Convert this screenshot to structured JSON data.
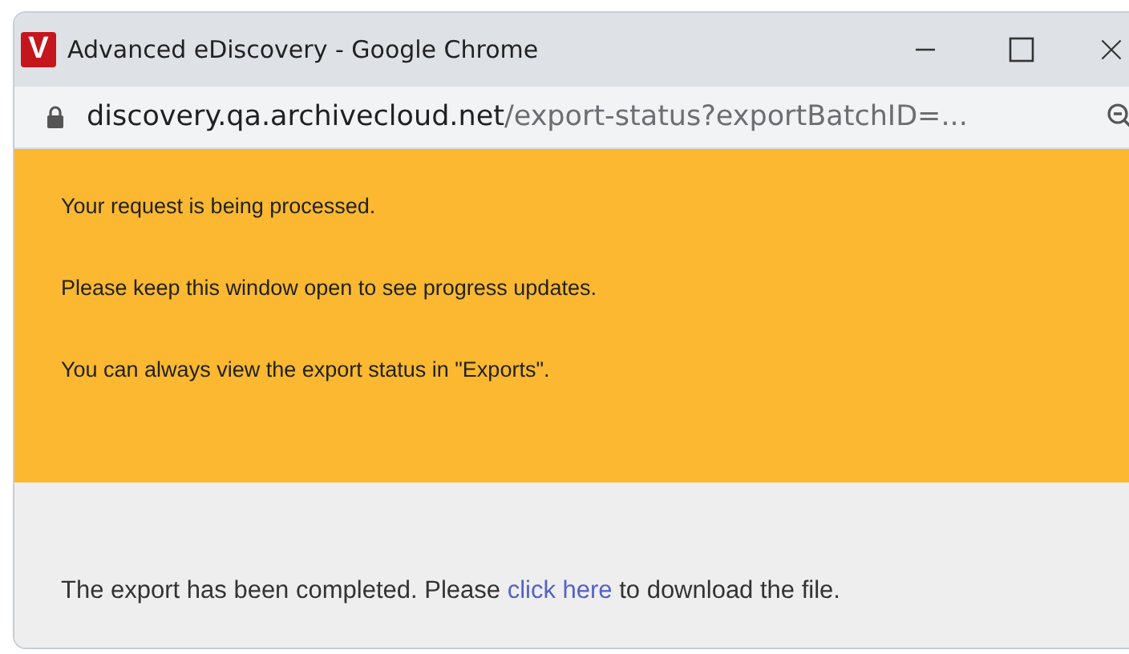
{
  "window": {
    "title": "Advanced eDiscovery - Google Chrome",
    "app_icon_letter": "V"
  },
  "address_bar": {
    "host": "discovery.qa.archivecloud.net",
    "path": "/export-status?exportBatchID=..."
  },
  "notice": {
    "lines": [
      "Your request is being processed.",
      "Please keep this window open to see progress updates.",
      "You can always view the export status in \"Exports\"."
    ]
  },
  "completion": {
    "before": "The export has been completed. Please ",
    "link": "click here",
    "after": " to download the file."
  }
}
